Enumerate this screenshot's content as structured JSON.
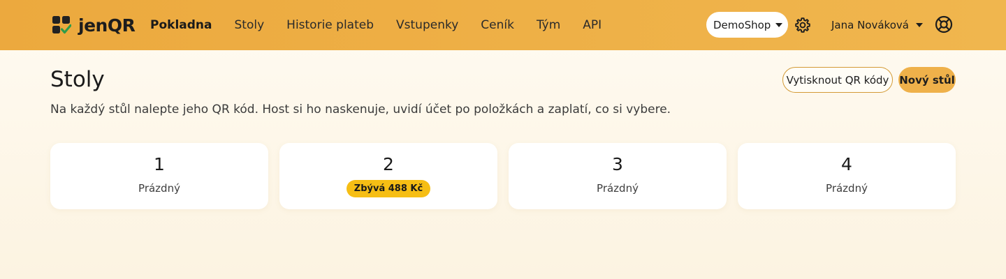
{
  "brand": {
    "name": "jenQR",
    "logo_icon": "qr-check-logo"
  },
  "nav": {
    "links": [
      {
        "label": "Pokladna",
        "active": true
      },
      {
        "label": "Stoly",
        "active": false
      },
      {
        "label": "Historie plateb",
        "active": false
      },
      {
        "label": "Vstupenky",
        "active": false
      },
      {
        "label": "Ceník",
        "active": false
      },
      {
        "label": "Tým",
        "active": false
      },
      {
        "label": "API",
        "active": false
      }
    ],
    "shop_select": {
      "value": "DemoShop"
    },
    "settings_icon": "gear-icon",
    "user": {
      "name": "Jana Nováková"
    },
    "help_icon": "lifebuoy-icon"
  },
  "page": {
    "title": "Stoly",
    "description": "Na každý stůl nalepte jeho QR kód. Host si ho naskenuje, uvidí účet po položkách a zaplatí, co si vybere.",
    "print_button": "Vytisknout QR kódy",
    "new_table_button": "Nový stůl"
  },
  "tables": [
    {
      "number": "1",
      "status": "Prázdný",
      "badge": null
    },
    {
      "number": "2",
      "status": null,
      "badge": "Zbývá 488 Kč"
    },
    {
      "number": "3",
      "status": "Prázdný",
      "badge": null
    },
    {
      "number": "4",
      "status": "Prázdný",
      "badge": null
    }
  ],
  "colors": {
    "navbar": "#eca93e",
    "accent": "#efb14a",
    "badge": "#f6be14",
    "logo_check": "#2e9c4a"
  }
}
